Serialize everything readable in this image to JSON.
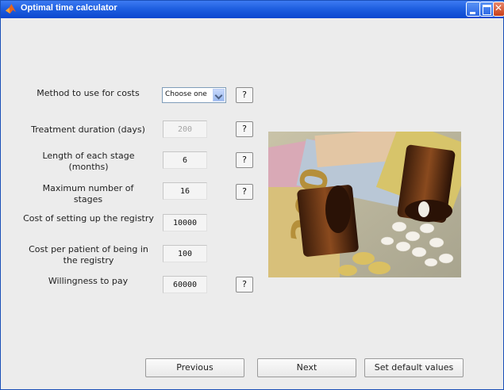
{
  "window": {
    "title": "Optimal time calculator"
  },
  "form": {
    "method_label": "Method to use for costs",
    "method_value": "Choose one",
    "treatment_label": "Treatment duration (days)",
    "treatment_value": "200",
    "stage_length_label": "Length of each stage (months)",
    "stage_length_value": "6",
    "max_stages_label": "Maximum number of stages",
    "max_stages_value": "16",
    "setup_cost_label": "Cost of setting up the registry",
    "setup_cost_value": "10000",
    "patient_cost_label": "Cost per patient of being in the registry",
    "patient_cost_value": "100",
    "wtp_label": "Willingness to pay",
    "wtp_value": "60000",
    "help_label": "?"
  },
  "buttons": {
    "previous": "Previous",
    "next": "Next",
    "defaults": "Set default values"
  },
  "colors": {
    "titlebar": "#1f5fe0",
    "background": "#ececec"
  }
}
